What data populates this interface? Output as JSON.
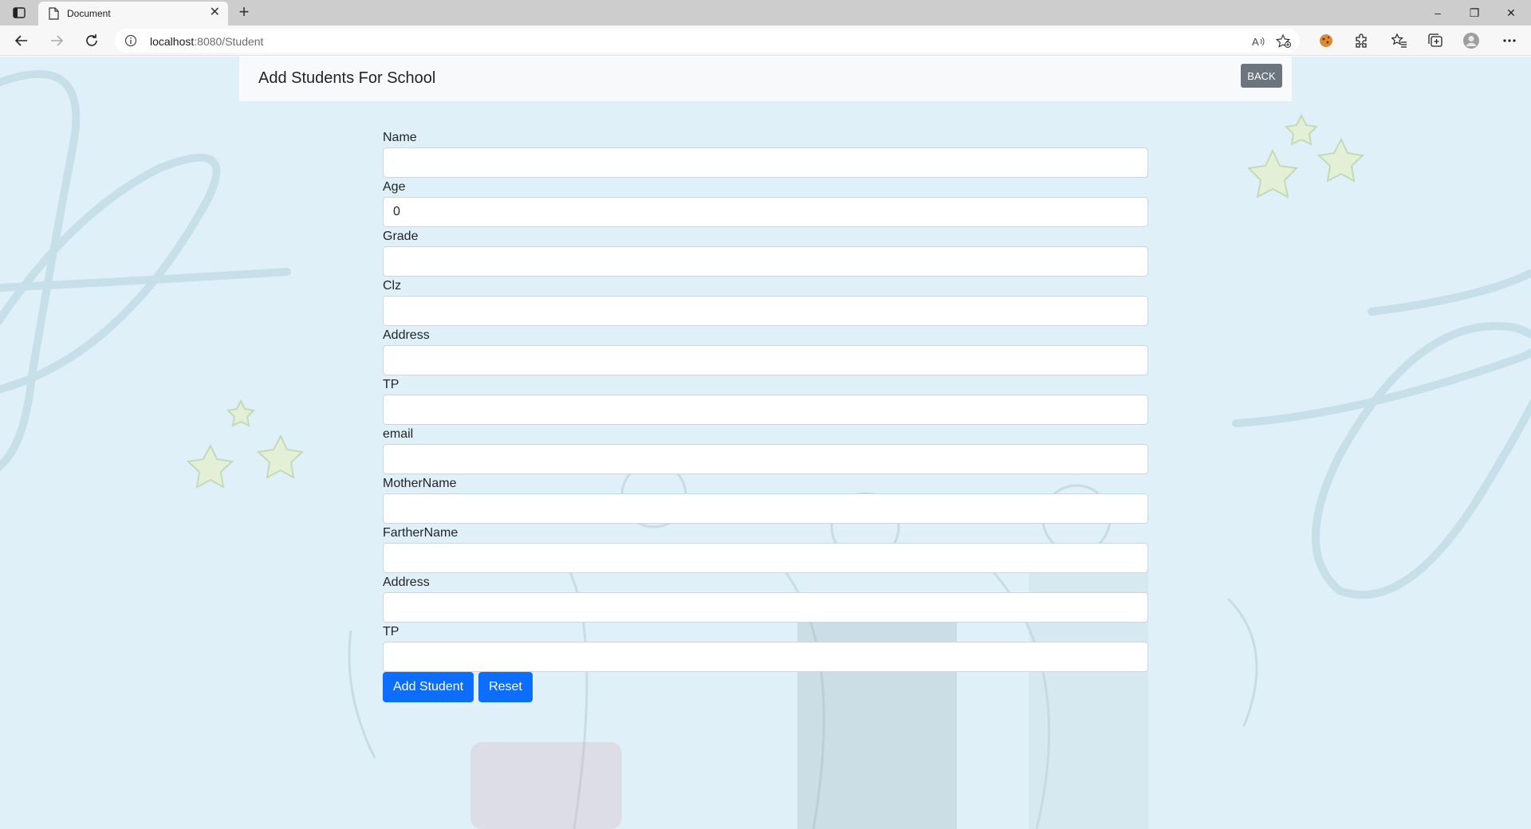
{
  "browser": {
    "tab_title": "Document",
    "tab_close": "✕",
    "new_tab": "+",
    "address_host": "localhost",
    "address_path": ":8080/Student",
    "window_controls": [
      "–",
      "❐",
      "✕"
    ]
  },
  "page": {
    "brand": "Add Students For School",
    "back_label": "BACK",
    "fields": [
      {
        "label": "Name",
        "value": ""
      },
      {
        "label": "Age",
        "value": "0"
      },
      {
        "label": "Grade",
        "value": ""
      },
      {
        "label": "Clz",
        "value": ""
      },
      {
        "label": "Address",
        "value": ""
      },
      {
        "label": "TP",
        "value": ""
      },
      {
        "label": "email",
        "value": ""
      },
      {
        "label": "MotherName",
        "value": ""
      },
      {
        "label": "FartherName",
        "value": ""
      },
      {
        "label": "Address",
        "value": ""
      },
      {
        "label": "TP",
        "value": ""
      }
    ],
    "submit_label": "Add Student",
    "reset_label": "Reset"
  },
  "colors": {
    "page_background": "#dff0f8",
    "primary": "#0d6efd",
    "secondary": "#6c757d",
    "navbar": "#f8f9fa"
  },
  "icons": [
    "tab-actions-icon",
    "document-icon",
    "back-arrow-icon",
    "forward-arrow-icon",
    "refresh-icon",
    "info-icon",
    "read-aloud-icon",
    "add-favorite-icon",
    "cookie-extension-icon",
    "extensions-icon",
    "favorites-icon",
    "collections-icon",
    "profile-icon",
    "more-menu-icon"
  ]
}
